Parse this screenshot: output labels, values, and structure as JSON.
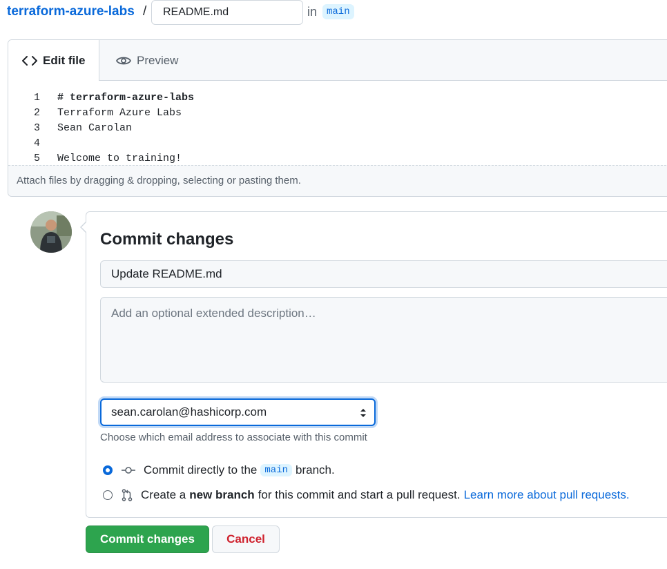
{
  "breadcrumb": {
    "repo": "terraform-azure-labs",
    "separator": "/",
    "filename": "README.md",
    "in_label": "in",
    "branch": "main"
  },
  "editor": {
    "tabs": [
      {
        "label": "Edit file",
        "icon": "code-icon",
        "active": true
      },
      {
        "label": "Preview",
        "icon": "eye-icon",
        "active": false
      }
    ],
    "lines": [
      {
        "num": "1",
        "text": "# terraform-azure-labs"
      },
      {
        "num": "2",
        "text": "Terraform Azure Labs"
      },
      {
        "num": "3",
        "text": "Sean Carolan"
      },
      {
        "num": "4",
        "text": ""
      },
      {
        "num": "5",
        "text": "Welcome to training!"
      }
    ],
    "attach_hint": "Attach files by dragging & dropping, selecting or pasting them."
  },
  "commit": {
    "title": "Commit changes",
    "summary_value": "Update README.md",
    "description_placeholder": "Add an optional extended description…",
    "email": "sean.carolan@hashicorp.com",
    "email_note": "Choose which email address to associate with this commit",
    "option_direct": {
      "prefix": "Commit directly to the",
      "branch": "main",
      "suffix": "branch.",
      "checked": true
    },
    "option_new_branch": {
      "prefix": "Create a",
      "bold": "new branch",
      "suffix": "for this commit and start a pull request.",
      "link": "Learn more about pull requests.",
      "checked": false
    },
    "submit_label": "Commit changes",
    "cancel_label": "Cancel"
  },
  "colors": {
    "link": "#0969da",
    "commit_button": "#2da44e",
    "cancel_text": "#cf222e"
  }
}
